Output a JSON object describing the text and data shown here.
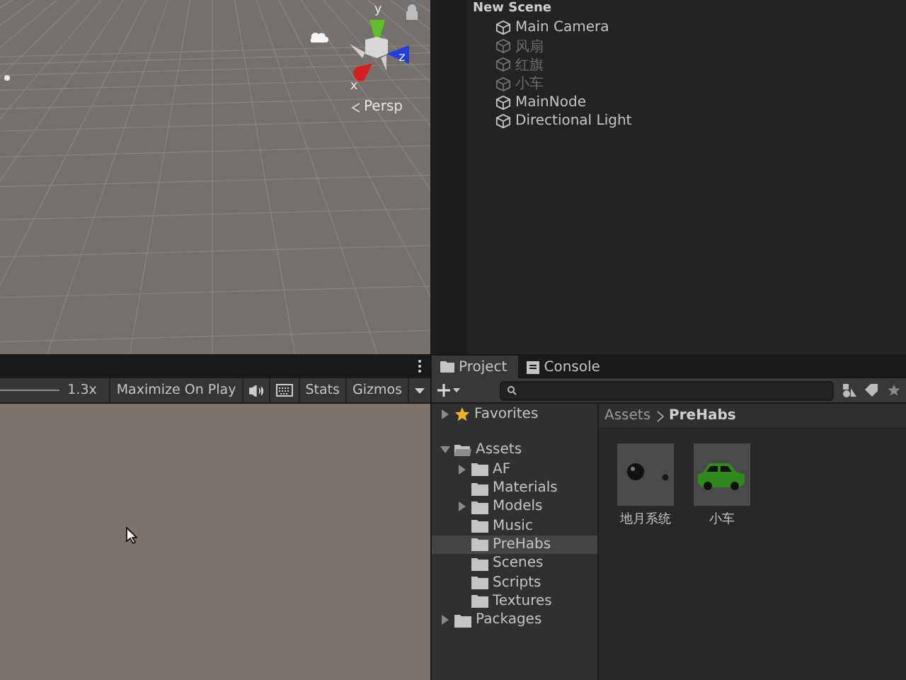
{
  "scene_view": {
    "axes": [
      {
        "label": "y",
        "kind": "y"
      },
      {
        "label": "z",
        "kind": "z"
      },
      {
        "label": "x",
        "kind": "x"
      }
    ],
    "projection": "Persp"
  },
  "hierarchy": {
    "scene": "New Scene",
    "items": [
      {
        "name": "Main Camera",
        "disabled": false
      },
      {
        "name": "风扇",
        "disabled": true
      },
      {
        "name": "红旗",
        "disabled": true
      },
      {
        "name": "小车",
        "disabled": true
      },
      {
        "name": "MainNode",
        "disabled": false
      },
      {
        "name": "Directional Light",
        "disabled": false
      }
    ]
  },
  "game_view": {
    "scale": "1.3x",
    "buttons": [
      "Maximize On Play",
      "Stats",
      "Gizmos"
    ]
  },
  "project": {
    "tabs": [
      {
        "label": "Project",
        "selected": true
      },
      {
        "label": "Console",
        "selected": false
      }
    ],
    "tree": [
      {
        "label": "Favorites",
        "kind": "favorites",
        "expanded": false,
        "selected": false
      },
      {
        "label": "Assets",
        "kind": "folder",
        "expanded": true,
        "selected": false,
        "children": [
          {
            "label": "AF",
            "kind": "folder",
            "expanded": false,
            "selected": false
          },
          {
            "label": "Materials",
            "kind": "folder",
            "selected": false
          },
          {
            "label": "Models",
            "kind": "folder",
            "expanded": false,
            "selected": false
          },
          {
            "label": "Music",
            "kind": "folder",
            "selected": false
          },
          {
            "label": "PreHabs",
            "kind": "folder",
            "selected": true
          },
          {
            "label": "Scenes",
            "kind": "folder",
            "selected": false
          },
          {
            "label": "Scripts",
            "kind": "folder",
            "selected": false
          },
          {
            "label": "Textures",
            "kind": "folder",
            "selected": false
          }
        ]
      },
      {
        "label": "Packages",
        "kind": "folder",
        "expanded": false,
        "selected": false
      }
    ],
    "breadcrumb": [
      "Assets",
      "PreHabs"
    ],
    "assets": [
      {
        "name": "地月系统",
        "kind": "planets"
      },
      {
        "name": "小车",
        "kind": "car"
      }
    ]
  }
}
